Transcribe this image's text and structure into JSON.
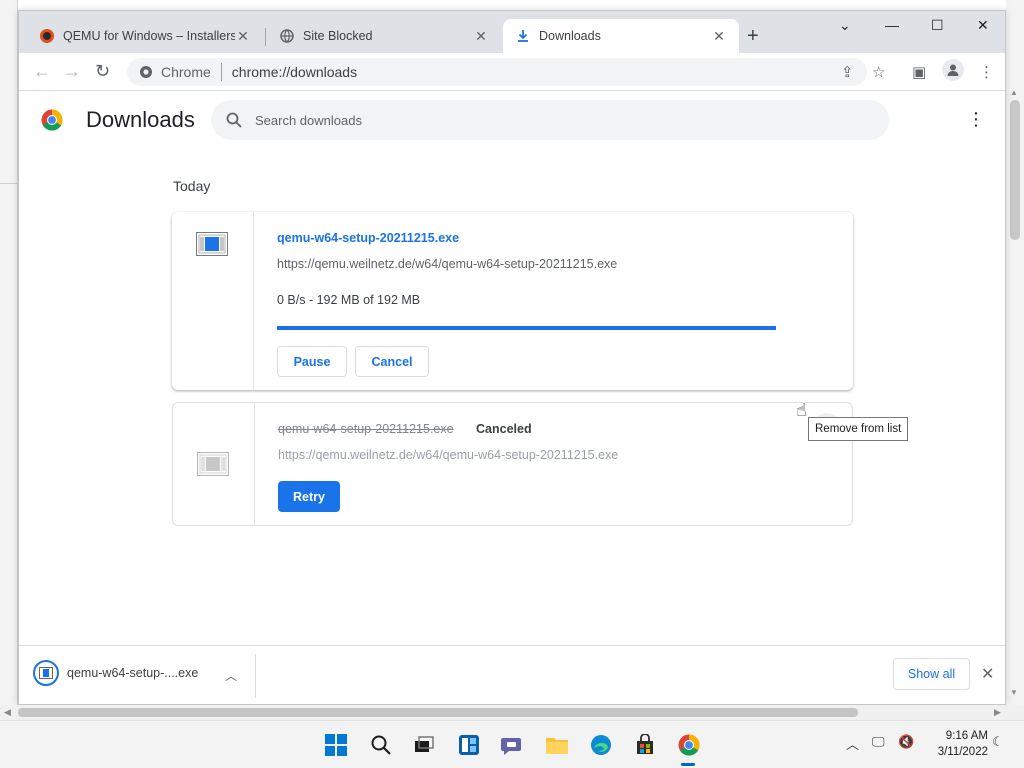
{
  "browser": {
    "tabs": [
      {
        "title": "QEMU for Windows – Installers (",
        "active": false
      },
      {
        "title": "Site Blocked",
        "active": false
      },
      {
        "title": "Downloads",
        "active": true
      }
    ],
    "omnibox": {
      "chip": "Chrome",
      "url": "chrome://downloads"
    }
  },
  "downloads_page": {
    "title": "Downloads",
    "search_placeholder": "Search downloads",
    "date_header": "Today",
    "items": [
      {
        "filename": "qemu-w64-setup-20211215.exe",
        "url": "https://qemu.weilnetz.de/w64/qemu-w64-setup-20211215.exe",
        "progress_text": "0 B/s - 192 MB of 192 MB",
        "progress_fraction": 1.0,
        "buttons": [
          "Pause",
          "Cancel"
        ]
      },
      {
        "filename": "qemu-w64-setup-20211215.exe",
        "status": "Canceled",
        "url": "https://qemu.weilnetz.de/w64/qemu-w64-setup-20211215.exe",
        "buttons": [
          "Retry"
        ]
      }
    ],
    "tooltip": "Remove from list"
  },
  "download_shelf": {
    "item_label": "qemu-w64-setup-....exe",
    "show_all": "Show all"
  },
  "taskbar": {
    "time": "9:16 AM",
    "date": "3/11/2022"
  },
  "colors": {
    "accent": "#1a73e8",
    "tabstrip": "#dee1e6"
  }
}
